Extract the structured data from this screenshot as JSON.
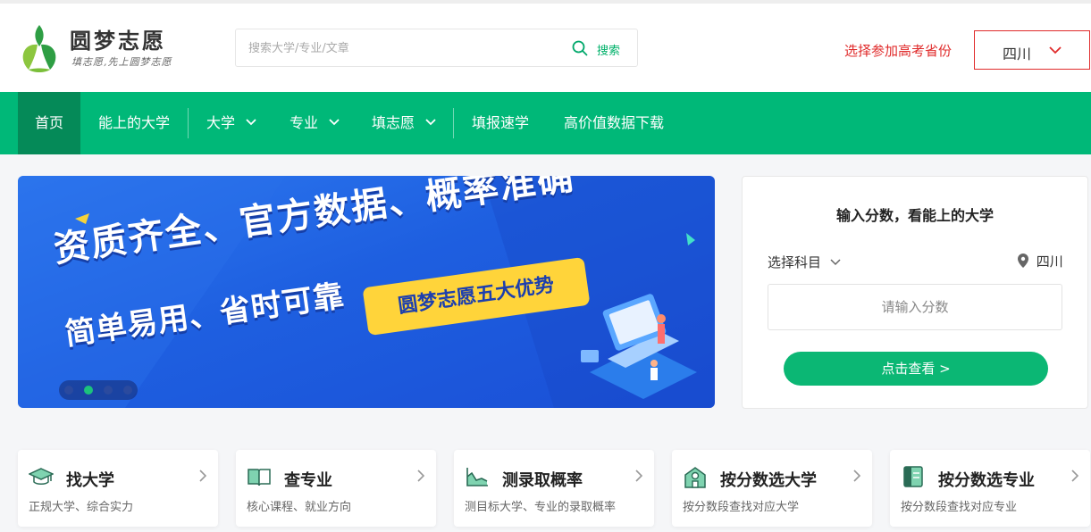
{
  "brand": {
    "name": "圆梦志愿",
    "slogan": "填志愿,先上圆梦志愿",
    "accent": "#00b878"
  },
  "search": {
    "placeholder": "搜索大学/专业/文章",
    "button_label": "搜索"
  },
  "province": {
    "label": "选择参加高考省份",
    "value": "四川"
  },
  "nav": {
    "items": [
      {
        "label": "首页",
        "active": true
      },
      {
        "label": "能上的大学"
      },
      {
        "label": "大学",
        "dropdown": true
      },
      {
        "label": "专业",
        "dropdown": true
      },
      {
        "label": "填志愿",
        "dropdown": true
      },
      {
        "label": "填报速学"
      },
      {
        "label": "高价值数据下载"
      }
    ]
  },
  "banner": {
    "line1": "资质齐全、官方数据、概率准确",
    "line2": "简单易用、省时可靠",
    "badge": "圆梦志愿五大优势",
    "active_slide": 2,
    "slide_count": 4
  },
  "score_card": {
    "title": "输入分数，看能上的大学",
    "subject_label": "选择科目",
    "location": "四川",
    "input_placeholder": "请输入分数",
    "button_label": "点击查看 >"
  },
  "features": [
    {
      "title": "找大学",
      "desc": "正规大学、综合实力",
      "icon": "graduation-cap-icon"
    },
    {
      "title": "查专业",
      "desc": "核心课程、就业方向",
      "icon": "book-icon"
    },
    {
      "title": "测录取概率",
      "desc": "测目标大学、专业的录取概率",
      "icon": "chart-icon"
    },
    {
      "title": "按分数选大学",
      "desc": "按分数段查找对应大学",
      "icon": "school-building-icon"
    },
    {
      "title": "按分数选专业",
      "desc": "按分数段查找对应专业",
      "icon": "notebook-icon"
    }
  ]
}
